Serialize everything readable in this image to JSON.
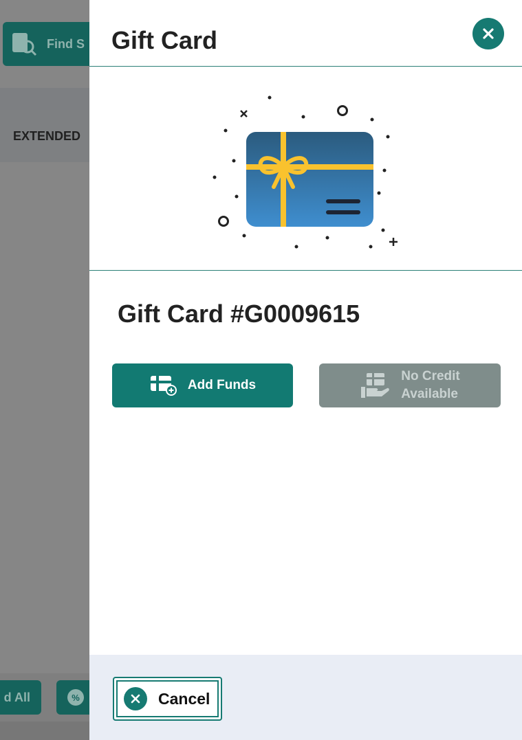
{
  "background": {
    "find_button_label": "Find S",
    "column_header": "EXTENDED",
    "add_all_label": "d All"
  },
  "drawer": {
    "title": "Gift Card",
    "card_number": "Gift Card #G0009615",
    "add_funds_label": "Add Funds",
    "no_credit_line1": "No Credit",
    "no_credit_line2": "Available",
    "cancel_label": "Cancel"
  },
  "colors": {
    "accent": "#167a72",
    "disabled": "#7f8d8b",
    "footer_bg": "#e9edf5",
    "ribbon": "#f9c22e",
    "card_top": "#2b5b7e",
    "card_bottom": "#3f8ecf"
  },
  "icons": {
    "find": "search-product-icon",
    "close": "close-icon",
    "gift_card": "gift-card-illustration",
    "add_funds": "gift-card-add-icon",
    "no_credit": "gift-card-hand-icon",
    "cancel": "cancel-circle-icon",
    "discount": "discount-badge-icon"
  }
}
